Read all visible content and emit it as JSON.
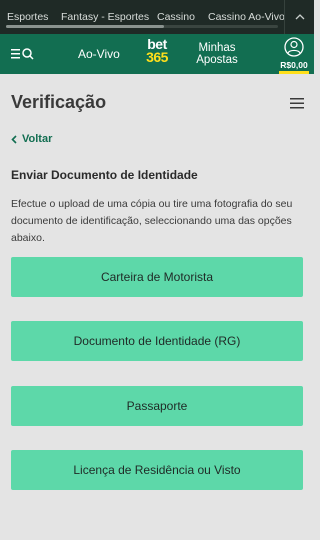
{
  "topbar": {
    "categories": [
      "Esportes",
      "Fantasy - Esportes",
      "Cassino",
      "Cassino Ao-Vivo"
    ]
  },
  "header": {
    "live_label": "Ao-Vivo",
    "logo_top": "bet",
    "logo_bottom": "365",
    "my_bets_line1": "Minhas",
    "my_bets_line2": "Apostas",
    "balance": "R$0,00"
  },
  "page": {
    "title": "Verificação",
    "back_label": "Voltar",
    "section_title": "Enviar Documento de Identidade",
    "description": "Efectue o upload de uma cópia ou tire uma fotografia do seu documento de identificação, seleccionando uma das opções abaixo.",
    "options": [
      "Carteira de Motorista",
      "Documento de Identidade (RG)",
      "Passaporte",
      "Licença de Residência ou Visto"
    ]
  },
  "colors": {
    "brand_green": "#126e51",
    "option_green": "#5dd8a9",
    "logo_yellow": "#ffdf1b"
  }
}
